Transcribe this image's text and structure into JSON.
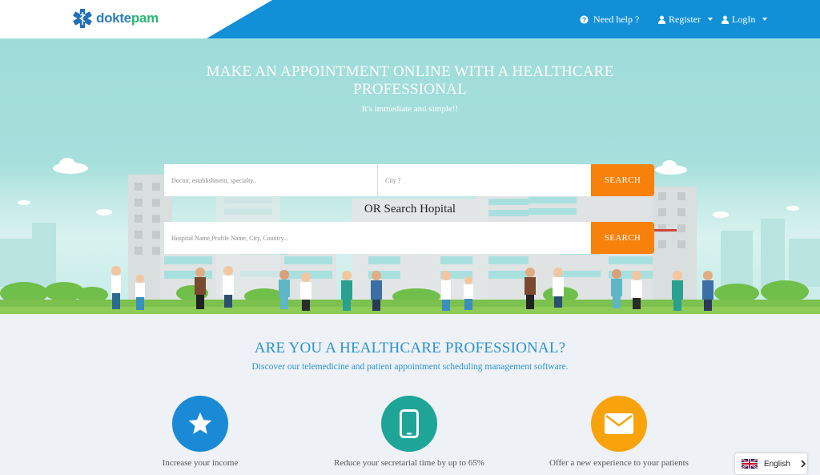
{
  "brand": {
    "name_part1": "dokte",
    "name_part2": "pam",
    "color_blue": "#2b7fc6",
    "color_green": "#2bb673"
  },
  "header": {
    "help_label": "Need help ?",
    "register_label": "Register",
    "login_label": "LogIn",
    "bg_color": "#1190d8"
  },
  "hero": {
    "title": "MAKE AN APPOINTMENT ONLINE WITH A HEALTHCARE PROFESSIONAL",
    "subtitle": "It's immediate and simple!!",
    "doctor_placeholder": "Doctor, establishment, specialty..",
    "city_placeholder": "City ?",
    "search_label": "SEARCH",
    "or_label": "OR Search Hopital",
    "hospital_placeholder": "Hospital Name,Profile Name, City, Country...",
    "search2_label": "SEARCH",
    "accent_color": "#f7810b"
  },
  "pro_section": {
    "title": "ARE YOU A HEALTHCARE PROFESSIONAL?",
    "subtitle": "Discover our telemedicine and patient appointment scheduling management software.",
    "features": [
      {
        "icon": "star-icon",
        "label": "Increase your income",
        "color": "#1b8ad6"
      },
      {
        "icon": "smartphone-icon",
        "label": "Reduce your secretarial time by up to 65%",
        "color": "#1fa597"
      },
      {
        "icon": "envelope-icon",
        "label": "Offer a new experience to your patients",
        "color": "#f9a30c"
      }
    ]
  },
  "language": {
    "label": "English",
    "flag_icon": "uk-flag-icon"
  }
}
